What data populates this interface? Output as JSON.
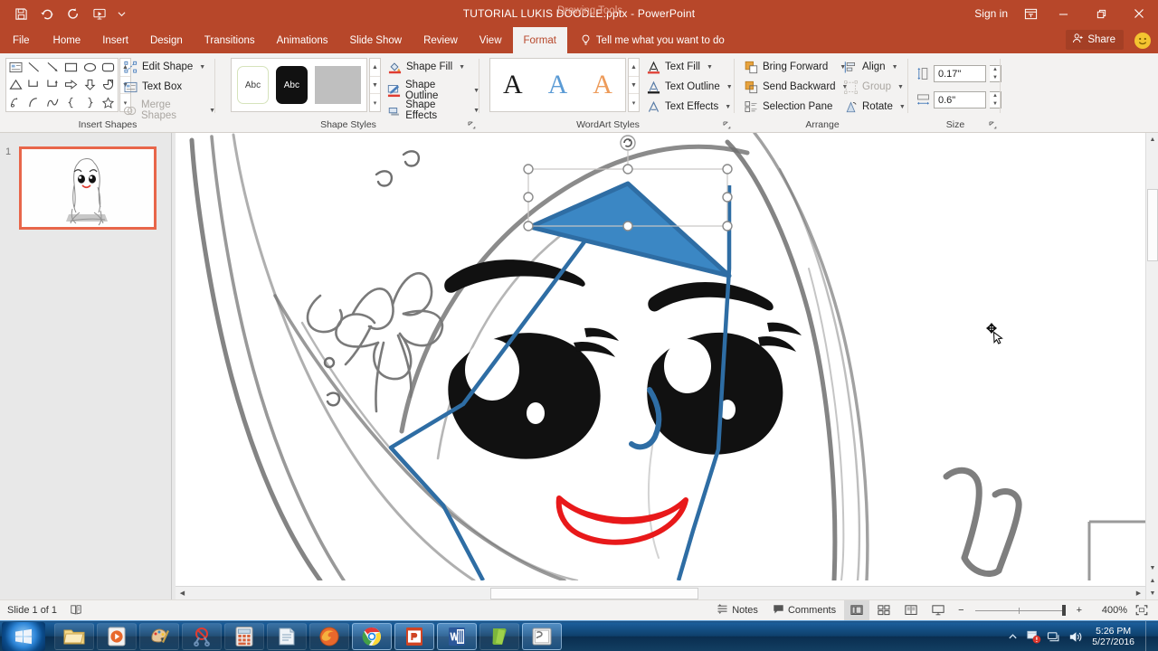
{
  "titlebar": {
    "quick_access": [
      {
        "name": "save-icon",
        "label": "Save"
      },
      {
        "name": "undo-icon",
        "label": "Undo"
      },
      {
        "name": "redo-icon",
        "label": "Redo"
      },
      {
        "name": "start-presentation-icon",
        "label": "Start From Beginning"
      },
      {
        "name": "customize-qat-icon",
        "label": "Customize Quick Access Toolbar"
      }
    ],
    "title": "TUTORIAL LUKIS DOODLE.pptx - PowerPoint",
    "contextual_tab_title": "Drawing Tools",
    "sign_in": "Sign in",
    "ribbon_display_options": "ribbon-display-options-icon",
    "minimize": "─",
    "restore": "❐",
    "close": "✕"
  },
  "tabs": [
    {
      "label": "File",
      "active": false
    },
    {
      "label": "Home",
      "active": false
    },
    {
      "label": "Insert",
      "active": false
    },
    {
      "label": "Design",
      "active": false
    },
    {
      "label": "Transitions",
      "active": false
    },
    {
      "label": "Animations",
      "active": false
    },
    {
      "label": "Slide Show",
      "active": false
    },
    {
      "label": "Review",
      "active": false
    },
    {
      "label": "View",
      "active": false
    },
    {
      "label": "Format",
      "active": true
    }
  ],
  "tellme": {
    "placeholder": "Tell me what you want to do"
  },
  "share": {
    "label": "Share"
  },
  "ribbon": {
    "insert_shapes": {
      "group_label": "Insert Shapes",
      "shapes": [
        "textbox-shape",
        "line-shape",
        "line-arrow-shape",
        "rectangle-shape",
        "oval-shape",
        "rounded-rectangle-shape",
        "triangle-shape",
        "elbow-connector-shape",
        "elbow-arrow-connector-shape",
        "right-arrow-shape",
        "down-arrow-shape",
        "pie-shape",
        "freeform-scribble-shape",
        "arc-shape",
        "curve-shape",
        "left-brace-shape",
        "right-brace-shape",
        "star-shape"
      ],
      "commands": [
        {
          "label": "Edit Shape",
          "icon": "edit-shape-icon",
          "dropdown": true,
          "disabled": false
        },
        {
          "label": "Text Box",
          "icon": "text-box-icon",
          "dropdown": false,
          "disabled": false
        },
        {
          "label": "Merge Shapes",
          "icon": "merge-shapes-icon",
          "dropdown": true,
          "disabled": true
        }
      ]
    },
    "shape_styles": {
      "group_label": "Shape Styles",
      "thumbs": [
        "Abc",
        "Abc",
        ""
      ],
      "commands": [
        {
          "label": "Shape Fill",
          "icon": "shape-fill-icon",
          "dropdown": true
        },
        {
          "label": "Shape Outline",
          "icon": "shape-outline-icon",
          "dropdown": true
        },
        {
          "label": "Shape Effects",
          "icon": "shape-effects-icon",
          "dropdown": true
        }
      ]
    },
    "wordart_styles": {
      "group_label": "WordArt Styles",
      "thumbs": [
        "A",
        "A",
        "A"
      ],
      "commands": [
        {
          "label": "Text Fill",
          "icon": "text-fill-icon",
          "dropdown": true
        },
        {
          "label": "Text Outline",
          "icon": "text-outline-icon",
          "dropdown": true
        },
        {
          "label": "Text Effects",
          "icon": "text-effects-icon",
          "dropdown": true
        }
      ]
    },
    "arrange": {
      "group_label": "Arrange",
      "commands_left": [
        {
          "label": "Bring Forward",
          "icon": "bring-forward-icon",
          "dropdown": true,
          "disabled": false
        },
        {
          "label": "Send Backward",
          "icon": "send-backward-icon",
          "dropdown": true,
          "disabled": false
        },
        {
          "label": "Selection Pane",
          "icon": "selection-pane-icon",
          "dropdown": false,
          "disabled": false
        }
      ],
      "commands_right": [
        {
          "label": "Align",
          "icon": "align-icon",
          "dropdown": true,
          "disabled": false
        },
        {
          "label": "Group",
          "icon": "group-icon",
          "dropdown": true,
          "disabled": true
        },
        {
          "label": "Rotate",
          "icon": "rotate-icon",
          "dropdown": true,
          "disabled": false
        }
      ]
    },
    "size": {
      "group_label": "Size",
      "height": {
        "icon": "shape-height-icon",
        "value": "0.17\""
      },
      "width": {
        "icon": "shape-width-icon",
        "value": "0.6\""
      }
    }
  },
  "slides_pane": {
    "slide_number": "1"
  },
  "statusbar": {
    "slide_indicator": "Slide 1 of 1",
    "accessibility_icon": "accessibility-checker-icon",
    "notes": "Notes",
    "comments": "Comments",
    "views": [
      {
        "name": "normal-view",
        "active": true
      },
      {
        "name": "slide-sorter-view",
        "active": false
      },
      {
        "name": "reading-view",
        "active": false
      },
      {
        "name": "slide-show-view",
        "active": false
      }
    ],
    "zoom_out": "−",
    "zoom_in": "+",
    "zoom_level": "400%",
    "fit_to_window": "fit-slide-to-window-icon"
  },
  "taskbar": {
    "start": "start-orb-icon",
    "buttons": [
      {
        "name": "windows-explorer-icon",
        "running": false
      },
      {
        "name": "media-player-icon",
        "running": false
      },
      {
        "name": "paint-icon",
        "running": false
      },
      {
        "name": "snipping-tool-icon",
        "running": false
      },
      {
        "name": "calculator-icon",
        "running": false
      },
      {
        "name": "notepad-icon",
        "running": false
      },
      {
        "name": "firefox-icon",
        "running": false
      },
      {
        "name": "chrome-icon",
        "running": true
      },
      {
        "name": "powerpoint-icon",
        "running": true
      },
      {
        "name": "word-icon",
        "running": true
      },
      {
        "name": "onenote-icon",
        "running": false
      },
      {
        "name": "camtasia-icon",
        "running": true
      }
    ],
    "tray": [
      {
        "name": "show-hidden-icons-icon"
      },
      {
        "name": "action-center-icon"
      },
      {
        "name": "network-icon"
      },
      {
        "name": "volume-icon"
      }
    ],
    "clock_time": "5:26 PM",
    "clock_date": "5/27/2016"
  },
  "colors": {
    "office_red": "#B7472A",
    "ribbon_bg": "#F3F2F1",
    "shape_blue_fill": "#3B87C4",
    "shape_blue_outline": "#2E6DA4",
    "selection_border": "#E8664A",
    "lips_red": "#E8191A"
  },
  "selection": {
    "shape": "triangle-shape",
    "rotation_handle": "rotate-handle",
    "handles": [
      "top-left",
      "top-center",
      "top-right",
      "middle-left",
      "middle-right",
      "bottom-left",
      "bottom-center",
      "bottom-right"
    ]
  },
  "cursor": {
    "name": "move-cursor"
  }
}
